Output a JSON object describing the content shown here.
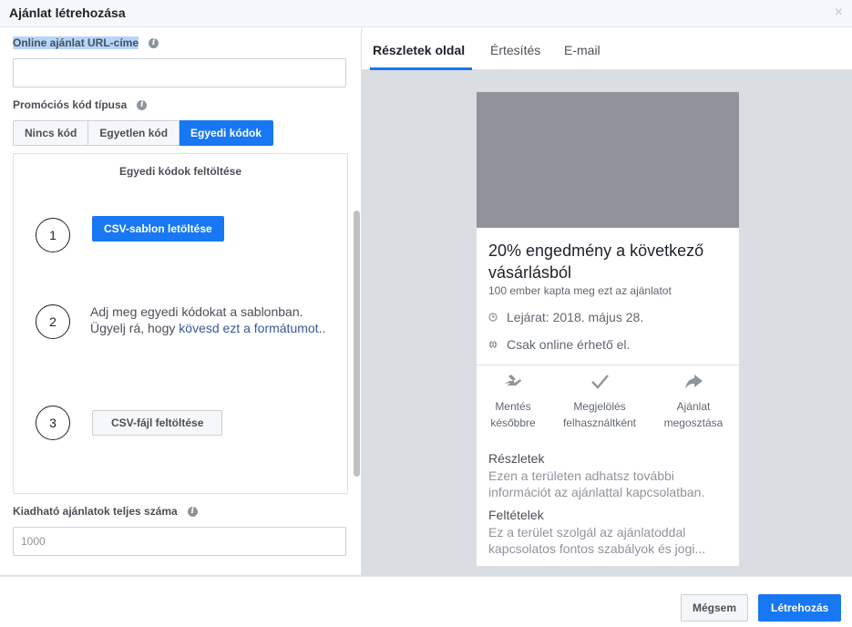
{
  "dialog": {
    "title": "Ajánlat létrehozása",
    "close_glyph": "×"
  },
  "form": {
    "url_label": "Online ajánlat URL-címe",
    "url_value": "",
    "promo_label": "Promóciós kód típusa",
    "promo_options": [
      "Nincs kód",
      "Egyetlen kód",
      "Egyedi kódok"
    ],
    "promo_selected": "Egyedi kódok",
    "upload_title": "Egyedi kódok feltöltése",
    "steps": [
      {
        "number": "1",
        "button": "CSV-sablon letöltése"
      },
      {
        "number": "2",
        "text": "Adj meg egyedi kódokat a sablonban. Ügyelj rá, hogy ",
        "link": "kövesd ezt a formátumot",
        "after": ".."
      },
      {
        "number": "3",
        "button": "CSV-fájl feltöltése"
      }
    ],
    "total_label": "Kiadható ajánlatok teljes száma",
    "total_placeholder": "1000"
  },
  "preview": {
    "tabs": [
      "Részletek oldal",
      "Értesítés",
      "E-mail"
    ],
    "active_tab": "Részletek oldal",
    "offer_title": "20% engedmény a következő vásárlásból",
    "claimed_text": "100 ember kapta meg ezt az ajánlatot",
    "expiry": "Lejárat: 2018. május 28.",
    "availability": "Csak online érhető el.",
    "actions": [
      {
        "icon": "save-hand-icon",
        "label_line1": "Mentés",
        "label_line2": "későbbre"
      },
      {
        "icon": "checkmark-icon",
        "label_line1": "Megjelölés",
        "label_line2": "felhasználtként"
      },
      {
        "icon": "share-arrow-icon",
        "label_line1": "Ajánlat",
        "label_line2": "megosztása"
      }
    ],
    "details_heading": "Részletek",
    "details_body": "Ezen a területen adhatsz további információt az ajánlattal kapcsolatban.",
    "terms_heading": "Feltételek",
    "terms_body": "Ez a terület szolgál az ajánlatoddal kapcsolatos fontos szabályok és jogi..."
  },
  "footer": {
    "cancel_label": "Mégsem",
    "create_label": "Létrehozás"
  },
  "colors": {
    "accent": "#1877f2",
    "link": "#385898",
    "preview_bg": "#dadde1",
    "image_placeholder": "#909399"
  }
}
